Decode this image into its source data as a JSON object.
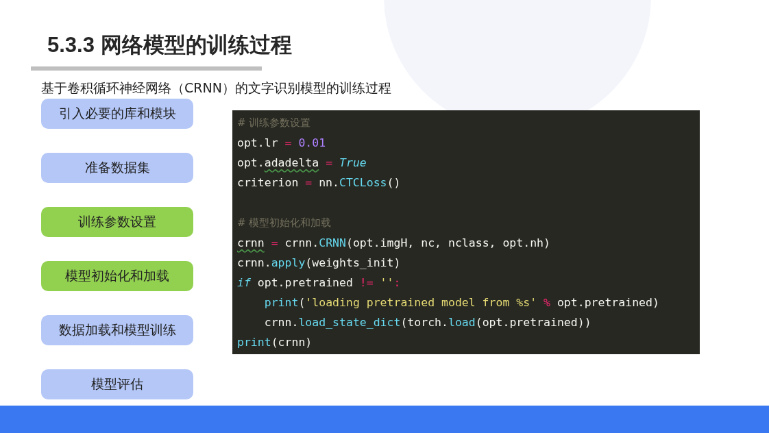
{
  "title": "5.3.3 网络模型的训练过程",
  "subtitle": "基于卷积循环神经网络（CRNN）的文字识别模型的训练过程",
  "steps": [
    {
      "label": "引入必要的库和模块",
      "selected": false
    },
    {
      "label": "准备数据集",
      "selected": false
    },
    {
      "label": "训练参数设置",
      "selected": true
    },
    {
      "label": "模型初始化和加载",
      "selected": true
    },
    {
      "label": "数据加载和模型训练",
      "selected": false
    },
    {
      "label": "模型评估",
      "selected": false
    }
  ],
  "code": {
    "sections": [
      {
        "lines": [
          {
            "tokens": [
              {
                "kind": "comment",
                "text": "# 训练参数设置"
              }
            ]
          },
          {
            "tokens": [
              {
                "kind": "plain",
                "text": "opt.lr"
              },
              {
                "kind": "op",
                "text": "="
              },
              {
                "kind": "number",
                "text": "0.01"
              }
            ]
          },
          {
            "tokens": [
              {
                "kind": "plain",
                "text": "opt."
              },
              {
                "kind": "plain",
                "text": "adadelta",
                "squiggle": true
              },
              {
                "kind": "op",
                "text": "="
              },
              {
                "kind": "keyword",
                "text": "True"
              }
            ]
          },
          {
            "tokens": [
              {
                "kind": "plain",
                "text": "criterion"
              },
              {
                "kind": "op",
                "text": "="
              },
              {
                "kind": "plain",
                "text": "nn."
              },
              {
                "kind": "func",
                "text": "CTCLoss"
              },
              {
                "kind": "plain",
                "text": "()"
              }
            ]
          }
        ]
      },
      {
        "lines": [
          {
            "tokens": [
              {
                "kind": "comment",
                "text": "# 模型初始化和加载"
              }
            ]
          },
          {
            "tokens": [
              {
                "kind": "plain",
                "text": "crnn",
                "squiggle": true
              },
              {
                "kind": "op",
                "text": "="
              },
              {
                "kind": "plain",
                "text": "crnn."
              },
              {
                "kind": "func",
                "text": "CRNN"
              },
              {
                "kind": "plain",
                "text": "(opt.imgH, nc, nclass, opt.nh)"
              }
            ]
          },
          {
            "tokens": [
              {
                "kind": "plain",
                "text": "crnn."
              },
              {
                "kind": "func",
                "text": "apply"
              },
              {
                "kind": "plain",
                "text": "(weights_init)"
              }
            ]
          },
          {
            "tokens": [
              {
                "kind": "keyword",
                "text": "if"
              },
              {
                "kind": "plain",
                "text": " opt.pretrained"
              },
              {
                "kind": "op",
                "text": "!="
              },
              {
                "kind": "string",
                "text": "''"
              },
              {
                "kind": "op",
                "text": ":"
              }
            ],
            "children": [
              {
                "tokens": [
                  {
                    "kind": "func",
                    "text": "print"
                  },
                  {
                    "kind": "plain",
                    "text": "("
                  },
                  {
                    "kind": "string",
                    "text": "'loading pretrained model from %s'"
                  },
                  {
                    "kind": "op",
                    "text": "%"
                  },
                  {
                    "kind": "plain",
                    "text": "opt.pretrained)"
                  }
                ]
              },
              {
                "tokens": [
                  {
                    "kind": "plain",
                    "text": "crnn."
                  },
                  {
                    "kind": "func",
                    "text": "load_state_dict"
                  },
                  {
                    "kind": "plain",
                    "text": "(torch."
                  },
                  {
                    "kind": "func",
                    "text": "load"
                  },
                  {
                    "kind": "plain",
                    "text": "(opt.pretrained))"
                  }
                ]
              }
            ]
          },
          {
            "tokens": [
              {
                "kind": "func",
                "text": "print"
              },
              {
                "kind": "plain",
                "text": "(crnn)"
              }
            ]
          }
        ]
      }
    ]
  }
}
